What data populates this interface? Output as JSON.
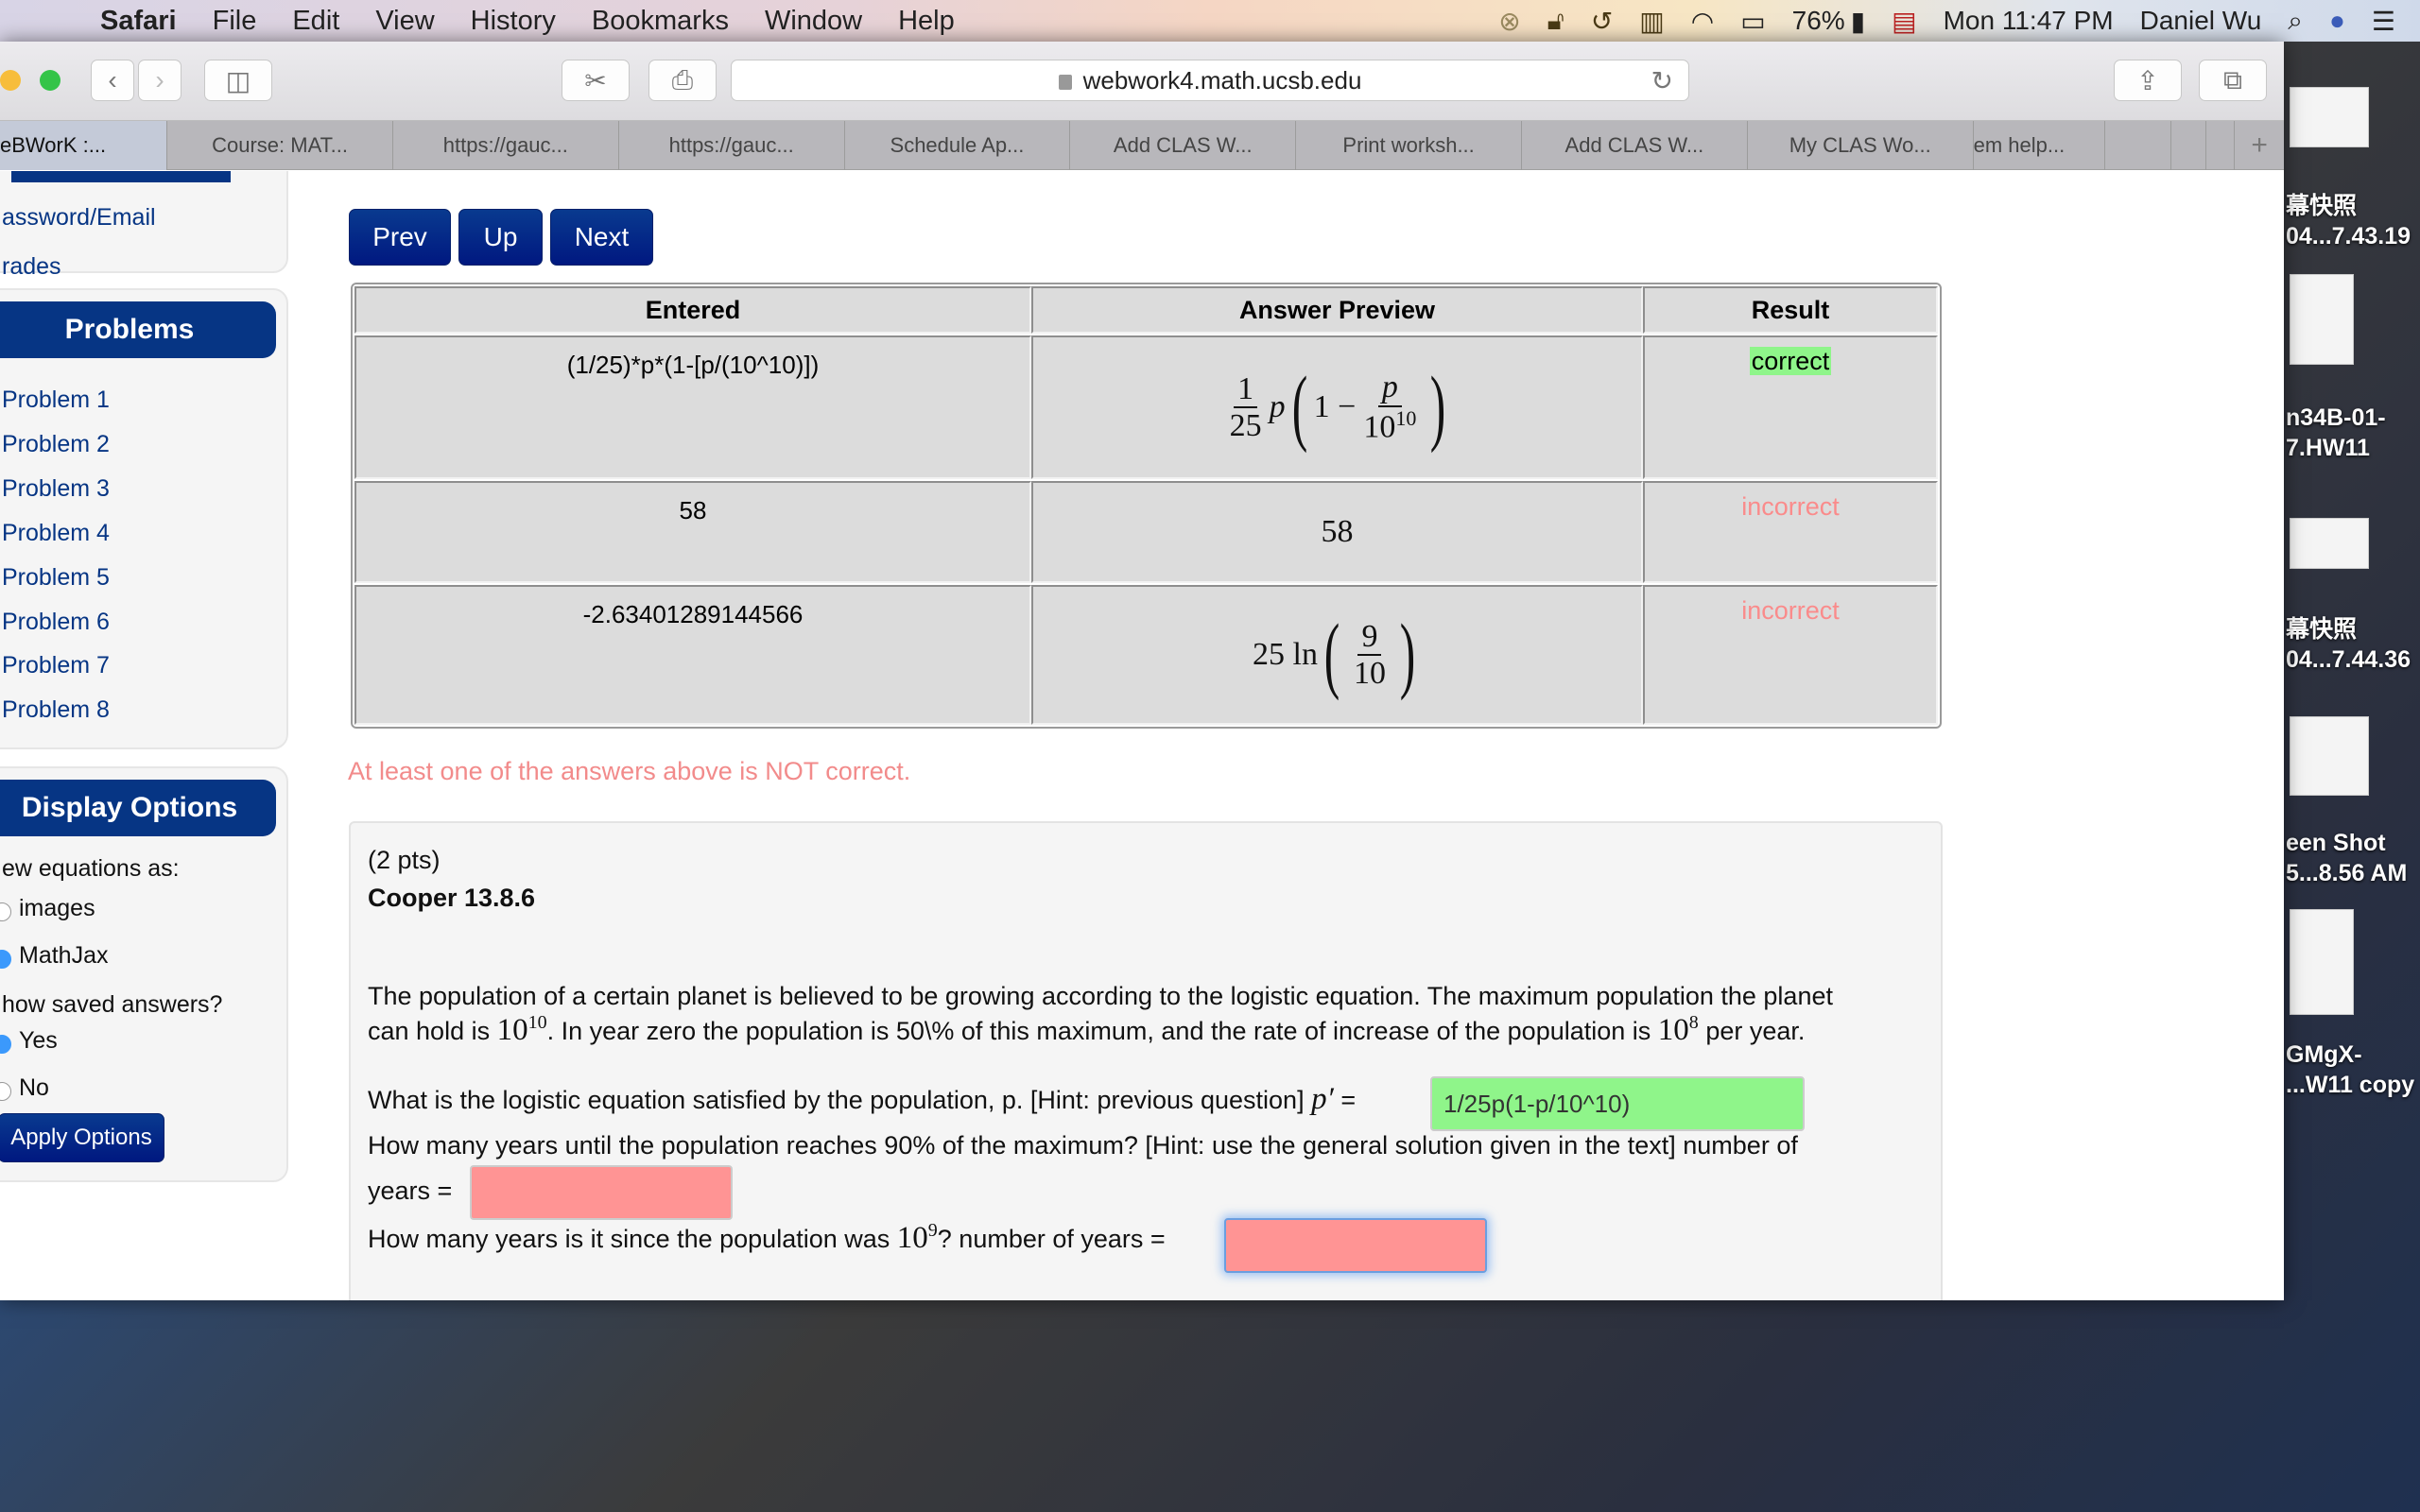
{
  "menubar": {
    "app": "Safari",
    "items": [
      "File",
      "Edit",
      "View",
      "History",
      "Bookmarks",
      "Window",
      "Help"
    ],
    "battery": "76%",
    "clock": "Mon 11:47 PM",
    "user": "Daniel Wu",
    "icons": [
      "creative-cloud-icon",
      "lock-icon",
      "time-machine-icon",
      "memory-icon",
      "wifi-icon",
      "airplay-icon",
      "battery-icon",
      "us-flag-icon",
      "spotlight-icon",
      "siri-icon",
      "notification-center-icon"
    ]
  },
  "browser": {
    "url": "webwork4.math.ucsb.edu",
    "tabs": [
      "eBWorK :...",
      "Course: MAT...",
      "https://gauc...",
      "https://gauc...",
      "Schedule Ap...",
      "Add CLAS W...",
      "Print worksh...",
      "Add CLAS W...",
      "My CLAS Wo...",
      "em help...",
      "",
      "",
      ""
    ],
    "new_tab": "+"
  },
  "sidebar": {
    "top_links": [
      "assword/Email",
      "rades"
    ],
    "problems_title": "Problems",
    "problems": [
      "Problem 1",
      "Problem 2",
      "Problem 3",
      "Problem 4",
      "Problem 5",
      "Problem 6",
      "Problem 7",
      "Problem 8"
    ],
    "display_title": "Display Options",
    "view_label": "ew equations as:",
    "view_options": [
      {
        "label": "images",
        "selected": false
      },
      {
        "label": "MathJax",
        "selected": true
      }
    ],
    "saved_label": "how saved answers?",
    "saved_options": [
      {
        "label": "Yes",
        "selected": true
      },
      {
        "label": "No",
        "selected": false
      }
    ],
    "apply_label": "Apply Options"
  },
  "nav": {
    "prev": "Prev",
    "up": "Up",
    "next": "Next"
  },
  "results": {
    "headers": [
      "Entered",
      "Answer Preview",
      "Result"
    ],
    "rows": [
      {
        "entered": "(1/25)*p*(1-[p/(10^10)])",
        "preview": "1/25 p(1 − p/10^10)",
        "result": "correct"
      },
      {
        "entered": "58",
        "preview": "58",
        "result": "incorrect"
      },
      {
        "entered": "-2.63401289144566",
        "preview": "25 ln(9/10)",
        "result": "incorrect"
      }
    ],
    "warning": "At least one of the answers above is NOT correct."
  },
  "problem": {
    "points": "(2 pts)",
    "title": "Cooper 13.8.6",
    "body_line1": "The population of a certain planet is believed to be growing according to the logistic equation. The maximum population the planet",
    "body_line2a": "can hold is",
    "body_line2b": ". In year zero the population is 50\\% of this maximum, and the rate of increase of the population is",
    "body_line2c": "per year.",
    "q1": "What is the logistic equation satisfied by the population, p. [Hint: previous question]",
    "q1_answer": "1/25p(1-p/10^10)",
    "q2_line1": "How many years until the population reaches 90% of the maximum? [Hint: use the general solution given in the text] number of",
    "q2_line2": "years =",
    "q2_answer": "",
    "q3a": "How many years is it since the population was",
    "q3b": "? number of years =",
    "q3_answer": ""
  },
  "desktop": {
    "files": [
      "幕快照\n04...7.43.19",
      "n34B-01-\n7.HW11",
      "幕快照\n04...7.44.36",
      "een Shot\n5...8.56 AM",
      "GMgX-\n...W11 copy"
    ]
  },
  "colors": {
    "brand": "#063584",
    "correct": "#8ff58a",
    "incorrect": "#fa8b8b",
    "answer_wrong": "#ff9494"
  }
}
